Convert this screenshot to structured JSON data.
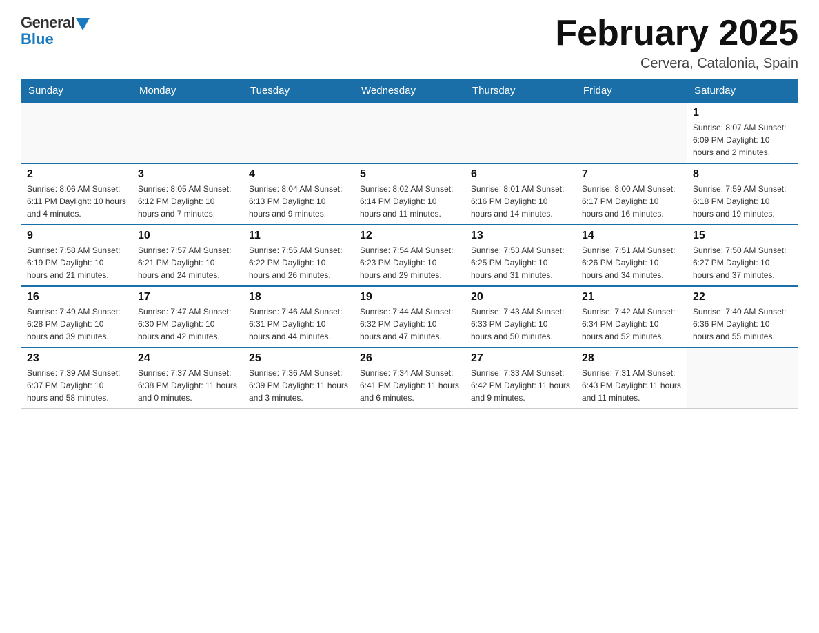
{
  "logo": {
    "general": "General",
    "blue": "Blue"
  },
  "title": "February 2025",
  "location": "Cervera, Catalonia, Spain",
  "weekdays": [
    "Sunday",
    "Monday",
    "Tuesday",
    "Wednesday",
    "Thursday",
    "Friday",
    "Saturday"
  ],
  "weeks": [
    [
      {
        "day": "",
        "info": ""
      },
      {
        "day": "",
        "info": ""
      },
      {
        "day": "",
        "info": ""
      },
      {
        "day": "",
        "info": ""
      },
      {
        "day": "",
        "info": ""
      },
      {
        "day": "",
        "info": ""
      },
      {
        "day": "1",
        "info": "Sunrise: 8:07 AM\nSunset: 6:09 PM\nDaylight: 10 hours\nand 2 minutes."
      }
    ],
    [
      {
        "day": "2",
        "info": "Sunrise: 8:06 AM\nSunset: 6:11 PM\nDaylight: 10 hours\nand 4 minutes."
      },
      {
        "day": "3",
        "info": "Sunrise: 8:05 AM\nSunset: 6:12 PM\nDaylight: 10 hours\nand 7 minutes."
      },
      {
        "day": "4",
        "info": "Sunrise: 8:04 AM\nSunset: 6:13 PM\nDaylight: 10 hours\nand 9 minutes."
      },
      {
        "day": "5",
        "info": "Sunrise: 8:02 AM\nSunset: 6:14 PM\nDaylight: 10 hours\nand 11 minutes."
      },
      {
        "day": "6",
        "info": "Sunrise: 8:01 AM\nSunset: 6:16 PM\nDaylight: 10 hours\nand 14 minutes."
      },
      {
        "day": "7",
        "info": "Sunrise: 8:00 AM\nSunset: 6:17 PM\nDaylight: 10 hours\nand 16 minutes."
      },
      {
        "day": "8",
        "info": "Sunrise: 7:59 AM\nSunset: 6:18 PM\nDaylight: 10 hours\nand 19 minutes."
      }
    ],
    [
      {
        "day": "9",
        "info": "Sunrise: 7:58 AM\nSunset: 6:19 PM\nDaylight: 10 hours\nand 21 minutes."
      },
      {
        "day": "10",
        "info": "Sunrise: 7:57 AM\nSunset: 6:21 PM\nDaylight: 10 hours\nand 24 minutes."
      },
      {
        "day": "11",
        "info": "Sunrise: 7:55 AM\nSunset: 6:22 PM\nDaylight: 10 hours\nand 26 minutes."
      },
      {
        "day": "12",
        "info": "Sunrise: 7:54 AM\nSunset: 6:23 PM\nDaylight: 10 hours\nand 29 minutes."
      },
      {
        "day": "13",
        "info": "Sunrise: 7:53 AM\nSunset: 6:25 PM\nDaylight: 10 hours\nand 31 minutes."
      },
      {
        "day": "14",
        "info": "Sunrise: 7:51 AM\nSunset: 6:26 PM\nDaylight: 10 hours\nand 34 minutes."
      },
      {
        "day": "15",
        "info": "Sunrise: 7:50 AM\nSunset: 6:27 PM\nDaylight: 10 hours\nand 37 minutes."
      }
    ],
    [
      {
        "day": "16",
        "info": "Sunrise: 7:49 AM\nSunset: 6:28 PM\nDaylight: 10 hours\nand 39 minutes."
      },
      {
        "day": "17",
        "info": "Sunrise: 7:47 AM\nSunset: 6:30 PM\nDaylight: 10 hours\nand 42 minutes."
      },
      {
        "day": "18",
        "info": "Sunrise: 7:46 AM\nSunset: 6:31 PM\nDaylight: 10 hours\nand 44 minutes."
      },
      {
        "day": "19",
        "info": "Sunrise: 7:44 AM\nSunset: 6:32 PM\nDaylight: 10 hours\nand 47 minutes."
      },
      {
        "day": "20",
        "info": "Sunrise: 7:43 AM\nSunset: 6:33 PM\nDaylight: 10 hours\nand 50 minutes."
      },
      {
        "day": "21",
        "info": "Sunrise: 7:42 AM\nSunset: 6:34 PM\nDaylight: 10 hours\nand 52 minutes."
      },
      {
        "day": "22",
        "info": "Sunrise: 7:40 AM\nSunset: 6:36 PM\nDaylight: 10 hours\nand 55 minutes."
      }
    ],
    [
      {
        "day": "23",
        "info": "Sunrise: 7:39 AM\nSunset: 6:37 PM\nDaylight: 10 hours\nand 58 minutes."
      },
      {
        "day": "24",
        "info": "Sunrise: 7:37 AM\nSunset: 6:38 PM\nDaylight: 11 hours\nand 0 minutes."
      },
      {
        "day": "25",
        "info": "Sunrise: 7:36 AM\nSunset: 6:39 PM\nDaylight: 11 hours\nand 3 minutes."
      },
      {
        "day": "26",
        "info": "Sunrise: 7:34 AM\nSunset: 6:41 PM\nDaylight: 11 hours\nand 6 minutes."
      },
      {
        "day": "27",
        "info": "Sunrise: 7:33 AM\nSunset: 6:42 PM\nDaylight: 11 hours\nand 9 minutes."
      },
      {
        "day": "28",
        "info": "Sunrise: 7:31 AM\nSunset: 6:43 PM\nDaylight: 11 hours\nand 11 minutes."
      },
      {
        "day": "",
        "info": ""
      }
    ]
  ]
}
